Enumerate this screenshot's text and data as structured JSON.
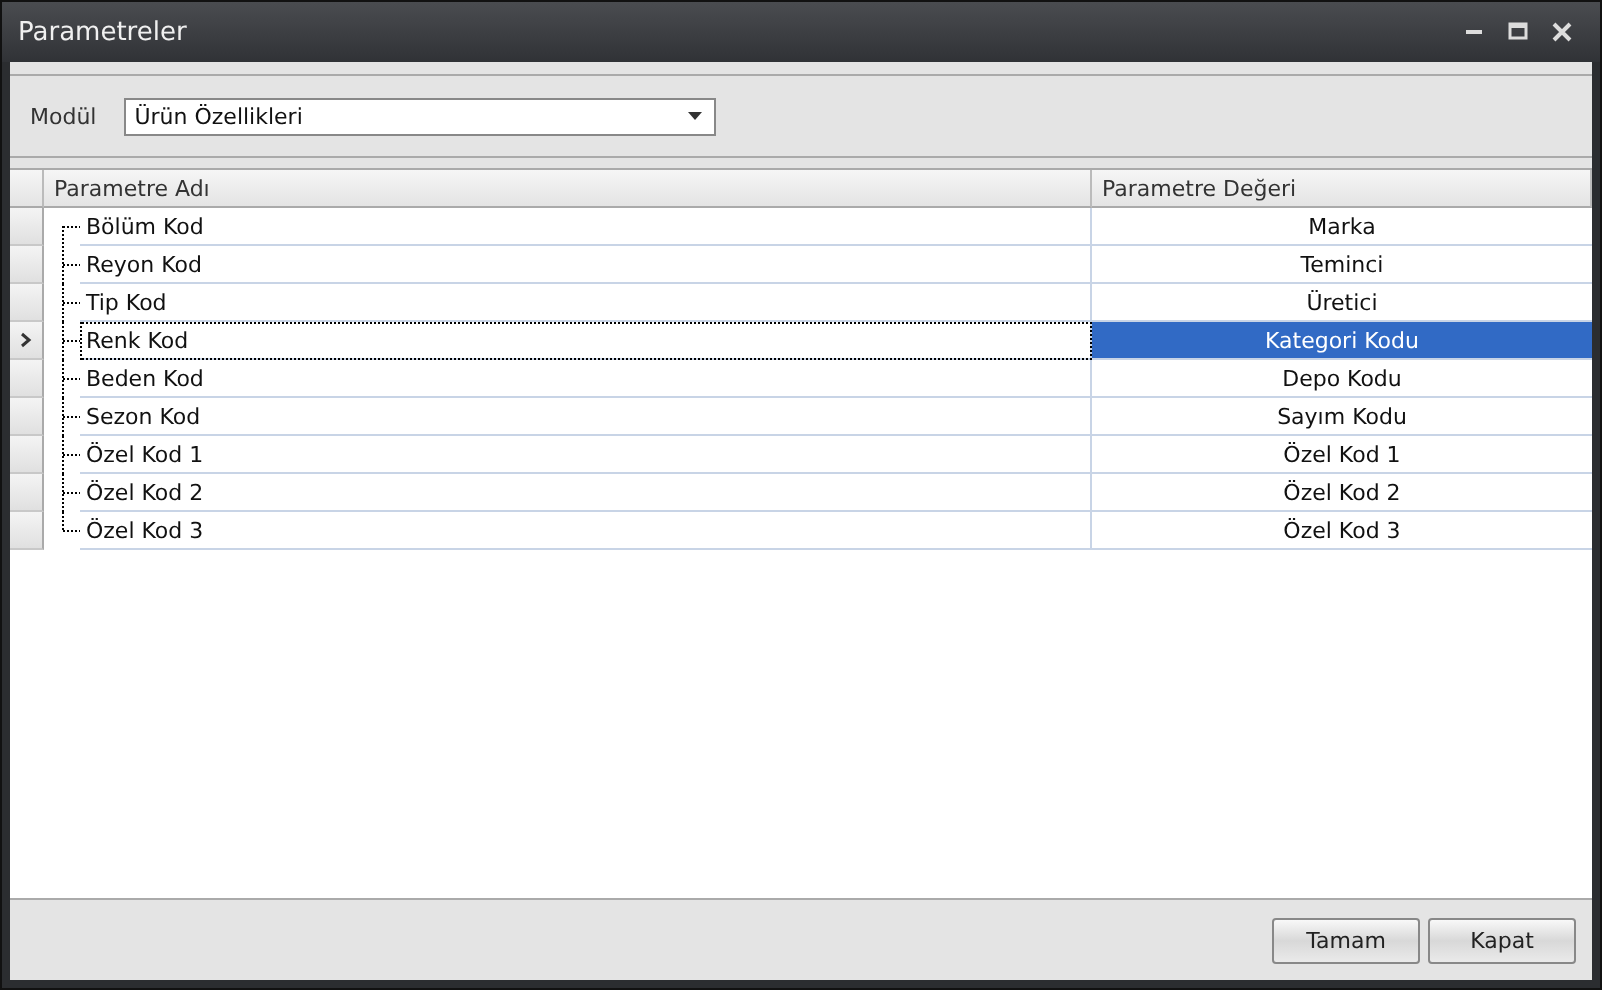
{
  "window": {
    "title": "Parametreler"
  },
  "module": {
    "label": "Modül",
    "value": "Ürün Özellikleri"
  },
  "table": {
    "columns": [
      "Parametre Adı",
      "Parametre Değeri"
    ],
    "rows": [
      {
        "name": "Bölüm Kod",
        "value": "Marka",
        "selected": false
      },
      {
        "name": "Reyon Kod",
        "value": "Teminci",
        "selected": false
      },
      {
        "name": "Tip Kod",
        "value": "Üretici",
        "selected": false
      },
      {
        "name": "Renk Kod",
        "value": "Kategori Kodu",
        "selected": true
      },
      {
        "name": "Beden Kod",
        "value": "Depo Kodu",
        "selected": false
      },
      {
        "name": "Sezon Kod",
        "value": "Sayım Kodu",
        "selected": false
      },
      {
        "name": "Özel Kod 1",
        "value": "Özel Kod 1",
        "selected": false
      },
      {
        "name": "Özel Kod 2",
        "value": "Özel Kod 2",
        "selected": false
      },
      {
        "name": "Özel Kod 3",
        "value": "Özel Kod 3",
        "selected": false
      }
    ]
  },
  "buttons": [
    "Tamam",
    "Kapat"
  ]
}
